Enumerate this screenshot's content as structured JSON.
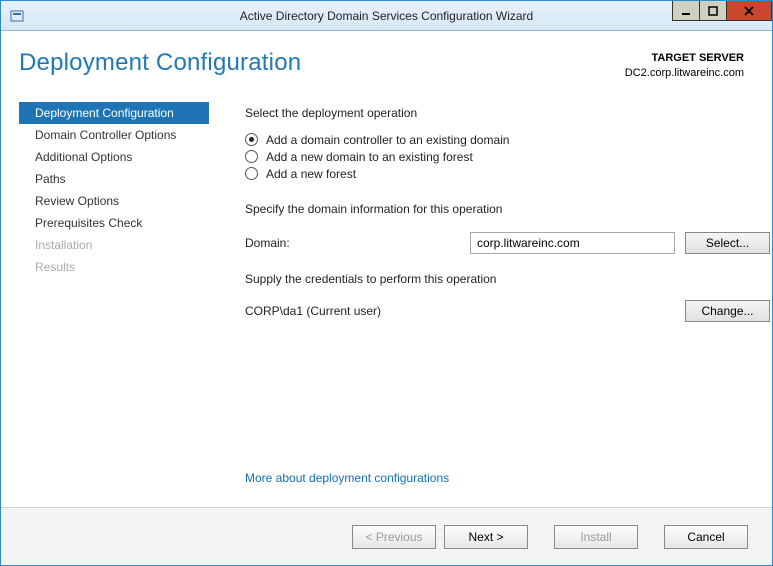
{
  "window": {
    "title": "Active Directory Domain Services Configuration Wizard"
  },
  "header": {
    "page_title": "Deployment Configuration",
    "target_label": "TARGET SERVER",
    "target_server": "DC2.corp.litwareinc.com"
  },
  "sidebar": {
    "items": [
      {
        "label": "Deployment Configuration",
        "active": true,
        "disabled": false
      },
      {
        "label": "Domain Controller Options",
        "active": false,
        "disabled": false
      },
      {
        "label": "Additional Options",
        "active": false,
        "disabled": false
      },
      {
        "label": "Paths",
        "active": false,
        "disabled": false
      },
      {
        "label": "Review Options",
        "active": false,
        "disabled": false
      },
      {
        "label": "Prerequisites Check",
        "active": false,
        "disabled": false
      },
      {
        "label": "Installation",
        "active": false,
        "disabled": true
      },
      {
        "label": "Results",
        "active": false,
        "disabled": true
      }
    ]
  },
  "main": {
    "select_op_label": "Select the deployment operation",
    "radios": [
      {
        "label": "Add a domain controller to an existing domain",
        "checked": true
      },
      {
        "label": "Add a new domain to an existing forest",
        "checked": false
      },
      {
        "label": "Add a new forest",
        "checked": false
      }
    ],
    "specify_label": "Specify the domain information for this operation",
    "domain_label": "Domain:",
    "domain_value": "corp.litwareinc.com",
    "select_button": "Select...",
    "supply_creds_label": "Supply the credentials to perform this operation",
    "creds_value": "CORP\\da1 (Current user)",
    "change_button": "Change...",
    "more_link": "More about deployment configurations"
  },
  "footer": {
    "previous": "< Previous",
    "next": "Next >",
    "install": "Install",
    "cancel": "Cancel"
  }
}
